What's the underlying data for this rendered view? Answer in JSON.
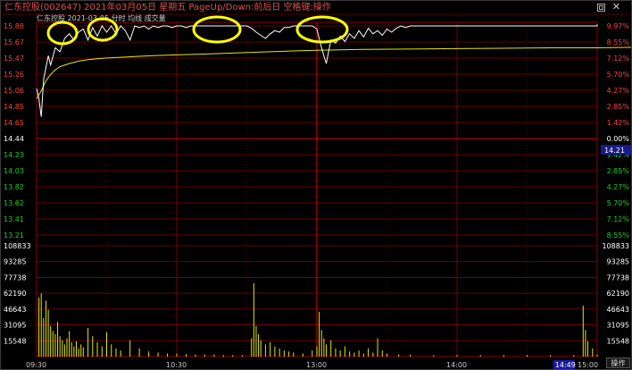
{
  "window": {
    "title": "仁东控股(002647) 2021年03月05日 星期五 PageUp/Down:前后日 空格键:操作",
    "legend": "仁东控股    2021-03-05 分时  均线  成交量"
  },
  "buttons": {
    "operate": "操作"
  },
  "colors": {
    "up": "#ff4040",
    "down": "#22cc22",
    "price_line": "#ffffff",
    "avg_line": "#e6e600",
    "volume": "#e6e600",
    "grid": "#8b0000",
    "highlight": "#ffff00",
    "cursor_time_bg": "#1a1aa0"
  },
  "chart_data": {
    "type": "line",
    "price_axis": {
      "prev_close": "14.44",
      "labels_left": [
        "15.88",
        "15.67",
        "15.47",
        "15.26",
        "15.06",
        "14.85",
        "14.65",
        "14.44",
        "14.23",
        "14.03",
        "13.82",
        "13.62",
        "13.41",
        "13.21"
      ],
      "labels_right": [
        "9.97%",
        "8.55%",
        "7.12%",
        "5.70%",
        "4.27%",
        "2.85%",
        "1.42%",
        "0.00%",
        "1.42%",
        "2.85%",
        "4.27%",
        "5.70%",
        "7.12%",
        "8.55%"
      ],
      "current_price": "14.21"
    },
    "volume_axis": {
      "labels": [
        "108833",
        "93285",
        "77738",
        "62190",
        "46643",
        "31095",
        "15548"
      ]
    },
    "time_axis": {
      "labels": [
        "09:30",
        "10:30",
        "13:00",
        "14:00",
        "15:00"
      ],
      "cursor_time": "14:49"
    },
    "price_series": {
      "name": "分时",
      "points": [
        [
          0,
          15.08
        ],
        [
          1,
          14.95
        ],
        [
          2,
          14.72
        ],
        [
          3,
          15.2
        ],
        [
          4,
          15.35
        ],
        [
          5,
          15.5
        ],
        [
          6,
          15.38
        ],
        [
          8,
          15.6
        ],
        [
          10,
          15.55
        ],
        [
          12,
          15.72
        ],
        [
          14,
          15.78
        ],
        [
          16,
          15.7
        ],
        [
          18,
          15.8
        ],
        [
          20,
          15.84
        ],
        [
          22,
          15.7
        ],
        [
          24,
          15.86
        ],
        [
          26,
          15.75
        ],
        [
          28,
          15.88
        ],
        [
          30,
          15.8
        ],
        [
          32,
          15.88
        ],
        [
          34,
          15.78
        ],
        [
          36,
          15.88
        ],
        [
          38,
          15.82
        ],
        [
          40,
          15.7
        ],
        [
          42,
          15.88
        ],
        [
          44,
          15.86
        ],
        [
          46,
          15.88
        ],
        [
          48,
          15.84
        ],
        [
          50,
          15.88
        ],
        [
          52,
          15.86
        ],
        [
          54,
          15.88
        ],
        [
          56,
          15.88
        ],
        [
          58,
          15.86
        ],
        [
          60,
          15.88
        ],
        [
          62,
          15.88
        ],
        [
          64,
          15.86
        ],
        [
          66,
          15.88
        ],
        [
          68,
          15.88
        ],
        [
          70,
          15.88
        ],
        [
          72,
          15.88
        ],
        [
          74,
          15.88
        ],
        [
          76,
          15.88
        ],
        [
          78,
          15.88
        ],
        [
          80,
          15.88
        ],
        [
          82,
          15.88
        ],
        [
          84,
          15.88
        ],
        [
          86,
          15.88
        ],
        [
          88,
          15.88
        ],
        [
          90,
          15.88
        ],
        [
          92,
          15.85
        ],
        [
          94,
          15.8
        ],
        [
          96,
          15.76
        ],
        [
          98,
          15.72
        ],
        [
          100,
          15.78
        ],
        [
          102,
          15.82
        ],
        [
          104,
          15.8
        ],
        [
          106,
          15.86
        ],
        [
          108,
          15.86
        ],
        [
          110,
          15.88
        ],
        [
          112,
          15.88
        ],
        [
          114,
          15.88
        ],
        [
          116,
          15.88
        ],
        [
          118,
          15.88
        ],
        [
          120,
          15.84
        ],
        [
          122,
          15.6
        ],
        [
          123,
          15.5
        ],
        [
          124,
          15.4
        ],
        [
          125,
          15.55
        ],
        [
          126,
          15.7
        ],
        [
          128,
          15.66
        ],
        [
          130,
          15.75
        ],
        [
          132,
          15.68
        ],
        [
          134,
          15.78
        ],
        [
          136,
          15.72
        ],
        [
          138,
          15.82
        ],
        [
          140,
          15.74
        ],
        [
          142,
          15.85
        ],
        [
          144,
          15.78
        ],
        [
          146,
          15.82
        ],
        [
          148,
          15.76
        ],
        [
          150,
          15.84
        ],
        [
          152,
          15.8
        ],
        [
          154,
          15.85
        ],
        [
          156,
          15.88
        ],
        [
          158,
          15.86
        ],
        [
          160,
          15.88
        ],
        [
          165,
          15.88
        ],
        [
          170,
          15.88
        ],
        [
          175,
          15.88
        ],
        [
          180,
          15.88
        ],
        [
          190,
          15.88
        ],
        [
          200,
          15.88
        ],
        [
          210,
          15.88
        ],
        [
          220,
          15.88
        ],
        [
          230,
          15.88
        ],
        [
          240,
          15.88
        ],
        [
          245,
          15.88
        ],
        [
          248,
          15.88
        ],
        [
          250,
          15.9
        ],
        [
          252,
          15.88
        ],
        [
          260,
          15.88
        ],
        [
          270,
          15.88
        ],
        [
          279,
          15.88
        ]
      ]
    },
    "avg_series": {
      "name": "均线",
      "points": [
        [
          0,
          14.95
        ],
        [
          2,
          15.05
        ],
        [
          4,
          15.18
        ],
        [
          6,
          15.26
        ],
        [
          8,
          15.32
        ],
        [
          10,
          15.36
        ],
        [
          14,
          15.4
        ],
        [
          18,
          15.43
        ],
        [
          22,
          15.45
        ],
        [
          26,
          15.46
        ],
        [
          30,
          15.47
        ],
        [
          36,
          15.48
        ],
        [
          42,
          15.49
        ],
        [
          50,
          15.5
        ],
        [
          60,
          15.51
        ],
        [
          70,
          15.52
        ],
        [
          80,
          15.53
        ],
        [
          90,
          15.54
        ],
        [
          100,
          15.55
        ],
        [
          110,
          15.56
        ],
        [
          120,
          15.57
        ],
        [
          130,
          15.575
        ],
        [
          140,
          15.58
        ],
        [
          160,
          15.585
        ],
        [
          180,
          15.59
        ],
        [
          200,
          15.595
        ],
        [
          220,
          15.6
        ],
        [
          240,
          15.6
        ],
        [
          250,
          15.605
        ],
        [
          279,
          15.61
        ]
      ]
    },
    "volume_series": {
      "name": "成交量",
      "values": [
        [
          1,
          58000
        ],
        [
          2,
          62000
        ],
        [
          3,
          38000
        ],
        [
          4,
          55000
        ],
        [
          5,
          46000
        ],
        [
          6,
          30000
        ],
        [
          7,
          25000
        ],
        [
          8,
          22000
        ],
        [
          9,
          34000
        ],
        [
          10,
          20000
        ],
        [
          11,
          16000
        ],
        [
          12,
          12000
        ],
        [
          13,
          18000
        ],
        [
          14,
          25000
        ],
        [
          15,
          14000
        ],
        [
          16,
          10000
        ],
        [
          17,
          15000
        ],
        [
          18,
          8000
        ],
        [
          19,
          12000
        ],
        [
          20,
          9000
        ],
        [
          22,
          28000
        ],
        [
          24,
          20000
        ],
        [
          26,
          14000
        ],
        [
          28,
          10000
        ],
        [
          30,
          24000
        ],
        [
          32,
          12000
        ],
        [
          34,
          8000
        ],
        [
          36,
          6000
        ],
        [
          40,
          16000
        ],
        [
          44,
          8000
        ],
        [
          48,
          5000
        ],
        [
          52,
          4000
        ],
        [
          56,
          3000
        ],
        [
          60,
          3000
        ],
        [
          64,
          2500
        ],
        [
          68,
          2000
        ],
        [
          72,
          2000
        ],
        [
          76,
          2000
        ],
        [
          80,
          1500
        ],
        [
          84,
          1500
        ],
        [
          88,
          1500
        ],
        [
          92,
          18000
        ],
        [
          93,
          72000
        ],
        [
          94,
          30000
        ],
        [
          95,
          22000
        ],
        [
          96,
          16000
        ],
        [
          98,
          12000
        ],
        [
          100,
          14000
        ],
        [
          102,
          10000
        ],
        [
          104,
          8000
        ],
        [
          106,
          6000
        ],
        [
          108,
          5000
        ],
        [
          110,
          4000
        ],
        [
          114,
          3000
        ],
        [
          118,
          6000
        ],
        [
          120,
          10000
        ],
        [
          121,
          44000
        ],
        [
          122,
          26000
        ],
        [
          123,
          18000
        ],
        [
          124,
          12000
        ],
        [
          126,
          16000
        ],
        [
          128,
          8000
        ],
        [
          130,
          6000
        ],
        [
          132,
          10000
        ],
        [
          134,
          5000
        ],
        [
          136,
          4000
        ],
        [
          138,
          6000
        ],
        [
          140,
          3000
        ],
        [
          142,
          8000
        ],
        [
          144,
          4000
        ],
        [
          146,
          18000
        ],
        [
          148,
          6000
        ],
        [
          150,
          3000
        ],
        [
          155,
          2000
        ],
        [
          160,
          2000
        ],
        [
          170,
          1500
        ],
        [
          180,
          1500
        ],
        [
          190,
          1500
        ],
        [
          200,
          1500
        ],
        [
          210,
          1500
        ],
        [
          220,
          1500
        ],
        [
          230,
          1500
        ],
        [
          234,
          50000
        ],
        [
          235,
          26000
        ],
        [
          236,
          15000
        ],
        [
          238,
          8000
        ],
        [
          240,
          2000
        ]
      ]
    },
    "ylim_price": [
      13.0,
      15.88
    ],
    "ylim_volume": [
      0,
      108833
    ],
    "x_range": [
      0,
      240
    ],
    "grid": true
  }
}
